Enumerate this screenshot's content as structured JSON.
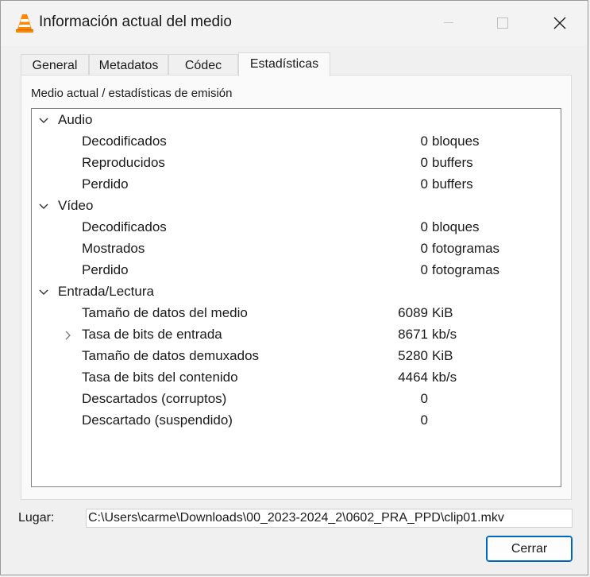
{
  "window": {
    "title": "Información actual del medio",
    "icon": "vlc-cone-icon",
    "accent": "#0067c0"
  },
  "tabs": [
    {
      "label": "General",
      "active": false
    },
    {
      "label": "Metadatos",
      "active": false
    },
    {
      "label": "Códec",
      "active": false
    },
    {
      "label": "Estadísticas",
      "active": true
    }
  ],
  "panel": {
    "caption": "Medio actual / estadísticas de emisión"
  },
  "stats": {
    "audio": {
      "label": "Audio",
      "expanded": true,
      "rows": [
        {
          "label": "Decodificados",
          "value": "0",
          "unit": "bloques"
        },
        {
          "label": "Reproducidos",
          "value": "0",
          "unit": "buffers"
        },
        {
          "label": "Perdido",
          "value": "0",
          "unit": "buffers"
        }
      ]
    },
    "video": {
      "label": "Vídeo",
      "expanded": true,
      "rows": [
        {
          "label": "Decodificados",
          "value": "0",
          "unit": "bloques"
        },
        {
          "label": "Mostrados",
          "value": "0",
          "unit": "fotogramas"
        },
        {
          "label": "Perdido",
          "value": "0",
          "unit": "fotogramas"
        }
      ]
    },
    "input": {
      "label": "Entrada/Lectura",
      "expanded": true,
      "rows": [
        {
          "label": "Tamaño de datos del medio",
          "value": "6089",
          "unit": "KiB",
          "expandable": false
        },
        {
          "label": "Tasa de bits de entrada",
          "value": "8671",
          "unit": "kb/s",
          "expandable": true
        },
        {
          "label": "Tamaño de datos demuxados",
          "value": "5280",
          "unit": "KiB",
          "expandable": false
        },
        {
          "label": "Tasa de bits del contenido",
          "value": "4464",
          "unit": "kb/s",
          "expandable": false
        },
        {
          "label": "Descartados (corruptos)",
          "value": "0",
          "unit": "",
          "expandable": false
        },
        {
          "label": "Descartado (suspendido)",
          "value": "0",
          "unit": "",
          "expandable": false
        }
      ]
    }
  },
  "location": {
    "label": "Lugar:",
    "value": "C:\\Users\\carme\\Downloads\\00_2023-2024_2\\0602_PRA_PPD\\clip01.mkv"
  },
  "buttons": {
    "close_label": "Cerrar"
  }
}
